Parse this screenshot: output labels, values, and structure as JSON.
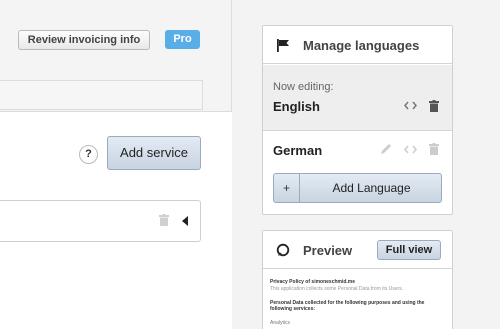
{
  "main": {
    "review_invoicing_label": "Review invoicing info",
    "pro_badge": "Pro",
    "help_label": "?",
    "add_service_label": "Add service"
  },
  "languages": {
    "title": "Manage languages",
    "now_editing_label": "Now editing:",
    "current_language": "English",
    "other_languages": [
      "German"
    ],
    "add_language_plus": "+",
    "add_language_label": "Add Language"
  },
  "preview": {
    "title": "Preview",
    "full_view_label": "Full view",
    "doc_title": "Privacy Policy of simoneschmid.me",
    "doc_subtitle": "This application collects some Personal Data from its Users.",
    "doc_heading": "Personal Data collected for the following purposes and using the following services:",
    "doc_item": "Analytics"
  },
  "colors": {
    "accent_blue": "#5aaee8",
    "button_border": "#9aabbd"
  }
}
